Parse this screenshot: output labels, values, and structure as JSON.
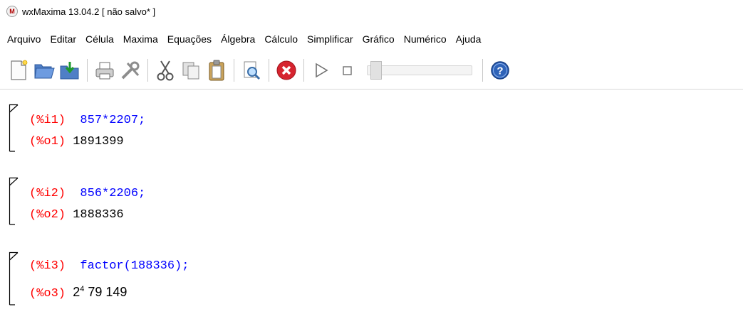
{
  "window": {
    "title": "wxMaxima 13.04.2 [ não salvo* ]",
    "icon": "wxmaxima-app-icon",
    "icon_letter": "M"
  },
  "menu": [
    "Arquivo",
    "Editar",
    "Célula",
    "Maxima",
    "Equações",
    "Álgebra",
    "Cálculo",
    "Simplificar",
    "Gráfico",
    "Numérico",
    "Ajuda"
  ],
  "toolbar": {
    "icons": [
      "new-document-icon",
      "open-folder-icon",
      "save-icon",
      "print-icon",
      "preferences-icon",
      "cut-icon",
      "copy-icon",
      "paste-icon",
      "find-icon",
      "interrupt-icon",
      "play-icon",
      "stop-icon",
      "animation-slider",
      "help-icon"
    ],
    "slider_level": 0
  },
  "cells": [
    {
      "input_label": "(%i1)",
      "input": "857*2207;",
      "output_label": "(%o1)",
      "output": "1891399"
    },
    {
      "input_label": "(%i2)",
      "input": "856*2206;",
      "output_label": "(%o2)",
      "output": "1888336"
    },
    {
      "input_label": "(%i3)",
      "input": "factor(188336);",
      "output_label": "(%o3)",
      "output_base": "2",
      "output_exp": "4",
      "output_rest": " 79 149"
    }
  ],
  "colors": {
    "label": "#ff0000",
    "input": "#0000ff",
    "output": "#000000"
  }
}
